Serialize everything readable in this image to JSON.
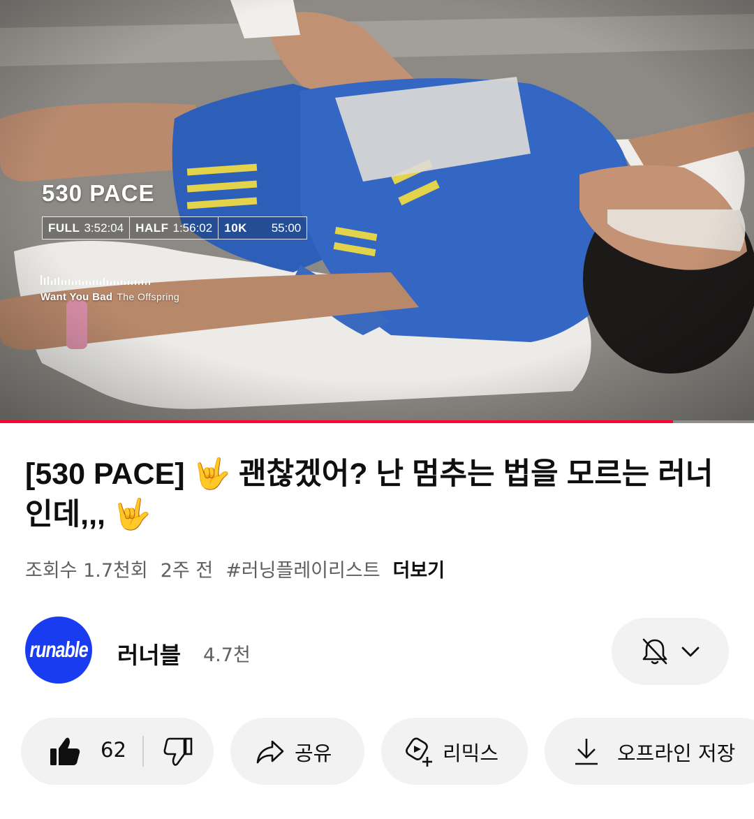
{
  "player": {
    "overlay_title": "530 PACE",
    "splits": [
      {
        "key": "FULL",
        "value": "3:52:04"
      },
      {
        "key": "HALF",
        "value": "1:56:02"
      },
      {
        "key": "10K",
        "value": "55:00"
      }
    ],
    "now_playing": {
      "song": "Want You Bad",
      "artist": "The Offspring"
    },
    "progress_fraction": 0.893,
    "progress_color": "#ff0033"
  },
  "video": {
    "title": "[530 PACE] 🤟 괜찮겠어? 난 멈추는 법을 모르는 러너인데,,, 🤟",
    "views": "조회수 1.7천회",
    "age": "2주 전",
    "hashtag": "#러닝플레이리스트",
    "more_label": "더보기"
  },
  "channel": {
    "avatar_text": "runable",
    "avatar_color": "#1a3cf0",
    "name": "러너블",
    "subscribers": "4.7천",
    "notification_icon": "bell-off-icon",
    "dropdown_icon": "chevron-down-icon"
  },
  "actions": {
    "like_count": "62",
    "share_label": "공유",
    "remix_label": "리믹스",
    "save_label": "오프라인 저장"
  }
}
